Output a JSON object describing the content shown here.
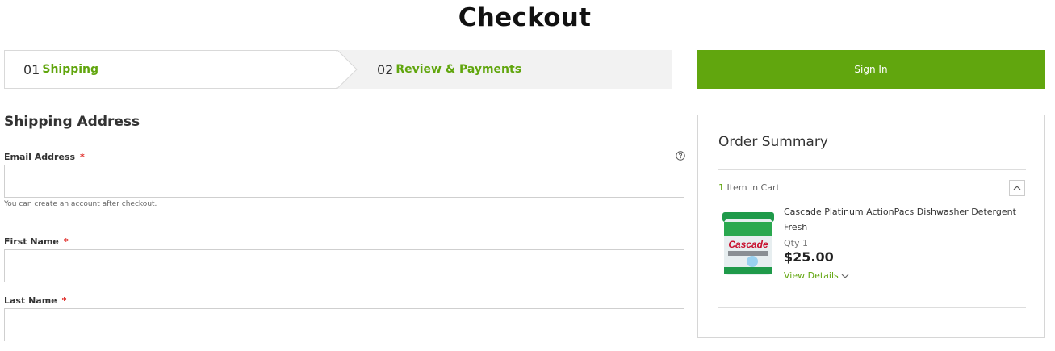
{
  "page": {
    "title": "Checkout"
  },
  "progress": {
    "steps": [
      {
        "number": "01",
        "label": "Shipping"
      },
      {
        "number": "02",
        "label": "Review & Payments"
      }
    ]
  },
  "signin": {
    "label": "Sign In"
  },
  "shipping": {
    "title": "Shipping Address",
    "required_mark": "*",
    "email": {
      "label": "Email Address",
      "value": "",
      "placeholder": "",
      "hint": "You can create an account after checkout."
    },
    "first_name": {
      "label": "First Name",
      "value": "",
      "placeholder": ""
    },
    "last_name": {
      "label": "Last Name",
      "value": "",
      "placeholder": ""
    }
  },
  "summary": {
    "title": "Order Summary",
    "cart_count": "1",
    "cart_label": "Item in Cart",
    "item": {
      "name": "Cascade Platinum ActionPacs Dishwasher Detergent Fresh",
      "qty_label": "Qty",
      "qty": "1",
      "price": "$25.00",
      "details_label": "View Details"
    }
  },
  "colors": {
    "accent": "#61a60e",
    "required": "#e02b27"
  },
  "icons": {
    "help": "question-circle-icon",
    "collapse": "chevron-up-icon",
    "details": "chevron-down-icon"
  }
}
